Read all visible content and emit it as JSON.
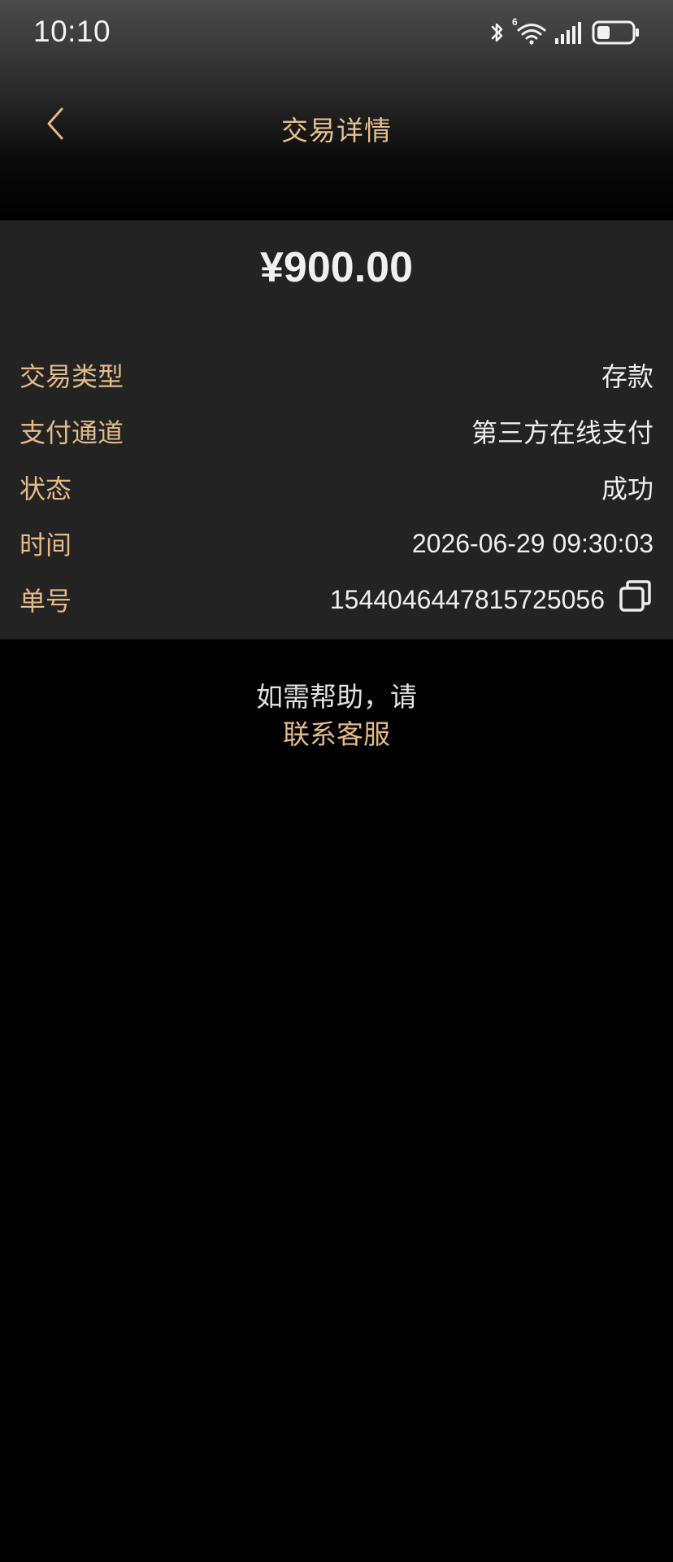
{
  "status_bar": {
    "time": "10:10",
    "icons": [
      "bluetooth-icon",
      "wifi-icon",
      "signal-icon",
      "battery-icon"
    ],
    "wifi_badge": "6"
  },
  "nav": {
    "title": "交易详情",
    "back_icon": "chevron-left-icon"
  },
  "transaction": {
    "amount": "¥900.00",
    "rows": [
      {
        "label": "交易类型",
        "value": "存款"
      },
      {
        "label": "支付通道",
        "value": "第三方在线支付"
      },
      {
        "label": "状态",
        "value": "成功"
      },
      {
        "label": "时间",
        "value": "2026-06-29 09:30:03"
      },
      {
        "label": "单号",
        "value": "1544046447815725056"
      }
    ],
    "copy_icon": "copy-icon"
  },
  "help": {
    "text": "如需帮助，请",
    "link": "联系客服"
  },
  "colors": {
    "accent": "#e3ba88",
    "background": "#000000",
    "card": "#232323",
    "text": "#eeeeee"
  }
}
